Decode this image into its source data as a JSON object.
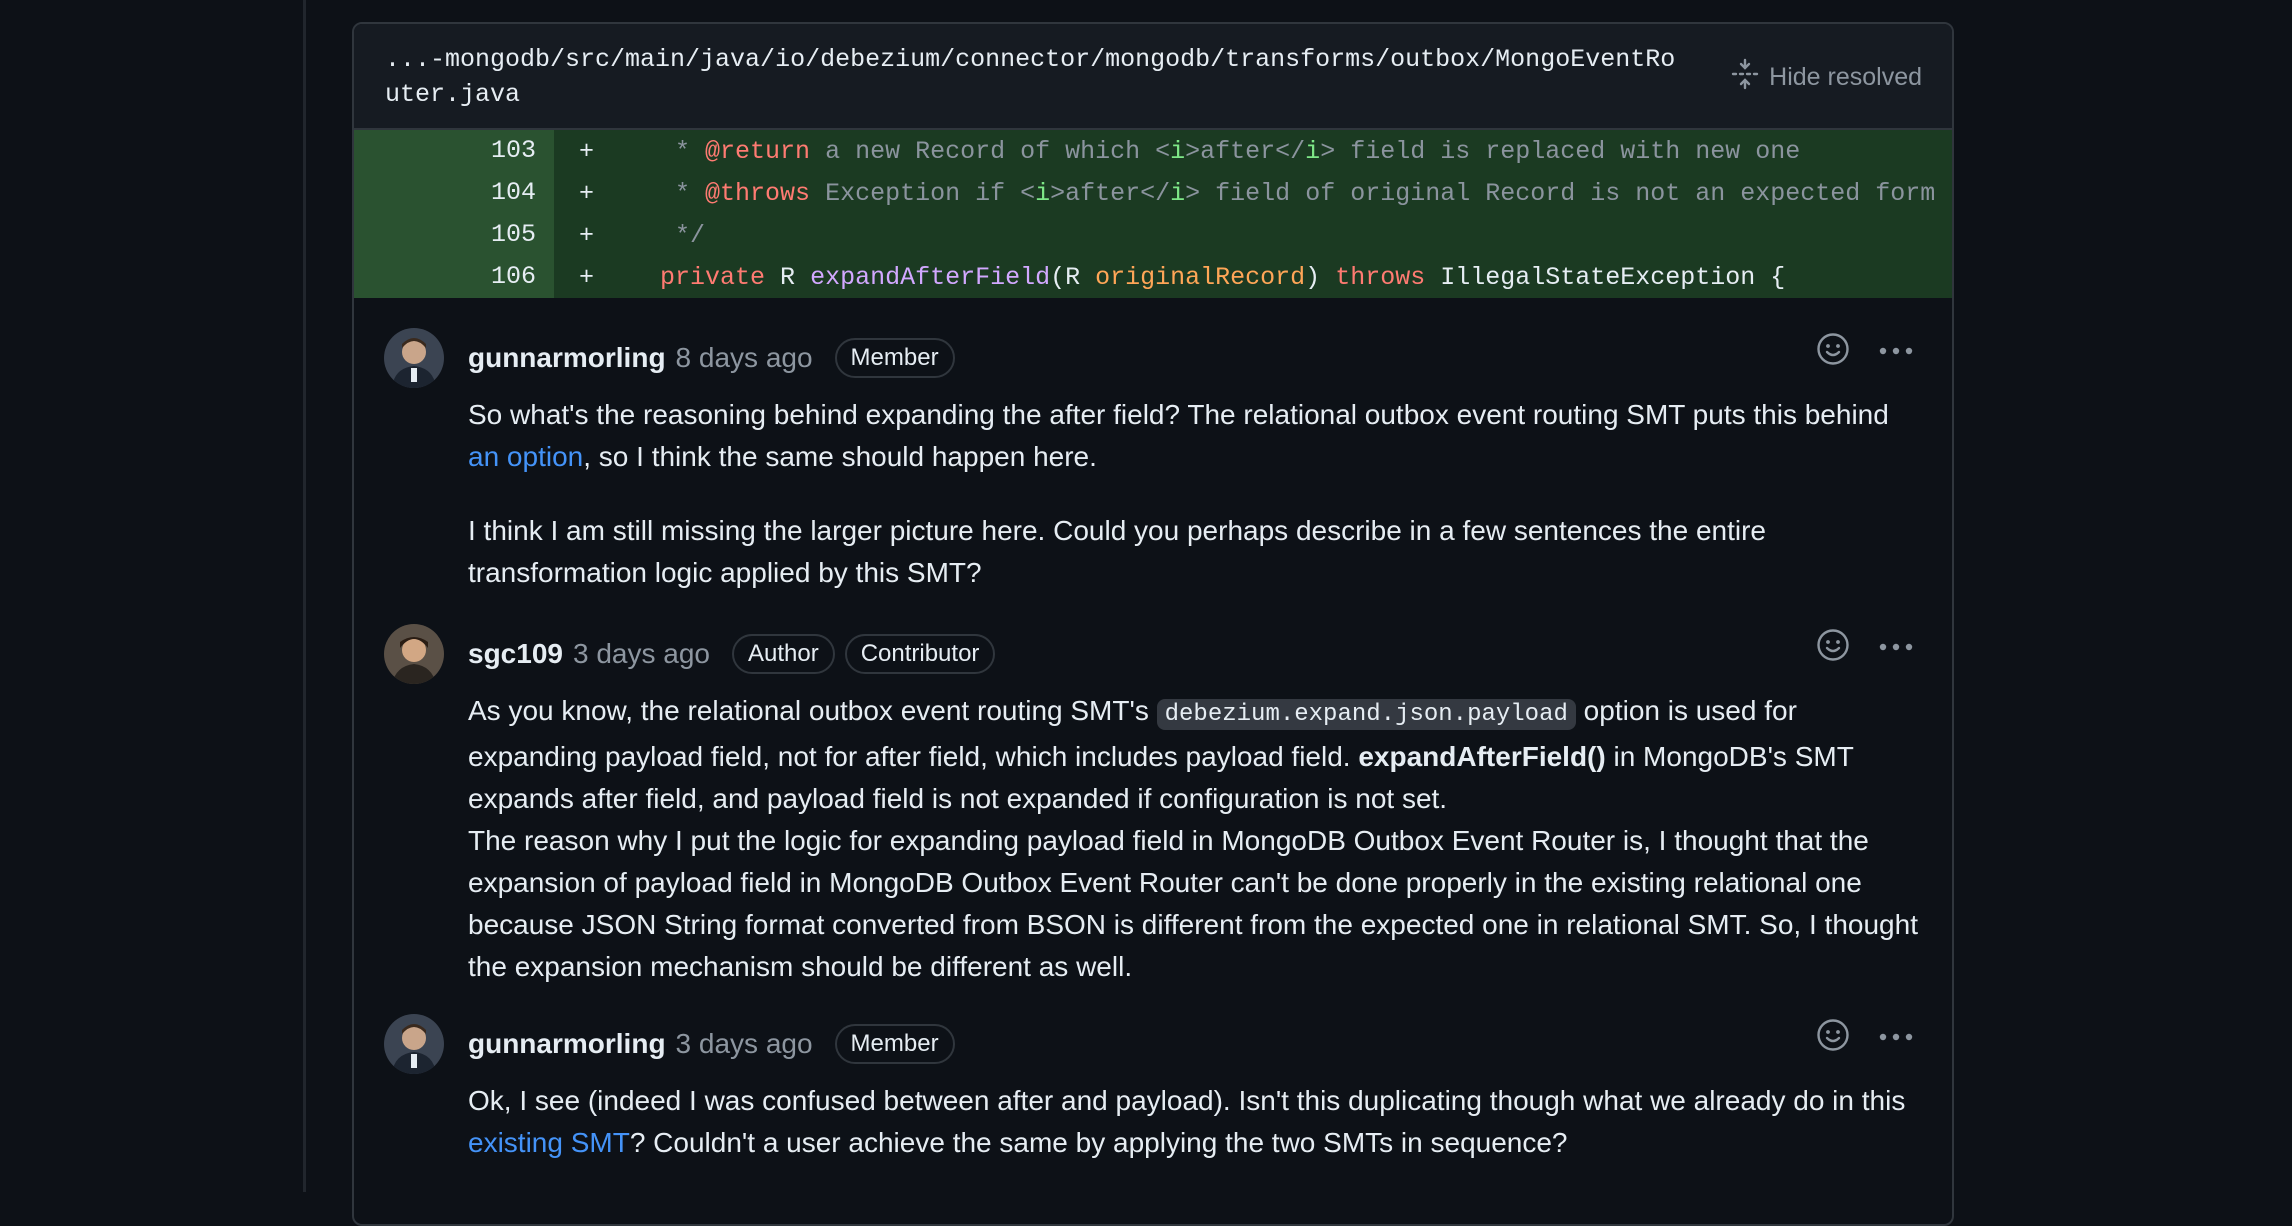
{
  "file": {
    "path": "...-mongodb/src/main/java/io/debezium/connector/mongodb/transforms/outbox/MongoEventRouter.java",
    "hide_resolved_label": "Hide resolved"
  },
  "diff": {
    "lines": [
      {
        "number": "103",
        "sign": "+"
      },
      {
        "number": "104",
        "sign": "+"
      },
      {
        "number": "105",
        "sign": "+"
      },
      {
        "number": "106",
        "sign": "+"
      }
    ],
    "code": {
      "l103": {
        "star": "     * ",
        "tag": "@return",
        "a": " a new Record of which <",
        "i": "i",
        "b": ">after</",
        "i2": "i",
        "c": "> field is replaced with new one"
      },
      "l104": {
        "star": "     * ",
        "tag": "@throws",
        "a": " Exception if <",
        "i": "i",
        "b": ">after</",
        "i2": "i",
        "c": "> field of original Record is not an expected form"
      },
      "l105": {
        "text": "     */"
      },
      "l106": {
        "indent": "    ",
        "kw1": "private",
        "t1": " R ",
        "fn": "expandAfterField",
        "t2": "(R ",
        "param": "originalRecord",
        "t3": ") ",
        "kw2": "throws",
        "t4": " IllegalStateException {"
      }
    }
  },
  "comments": [
    {
      "author": "gunnarmorling",
      "time": "8 days ago",
      "badges": [
        "Member"
      ],
      "p1_a": "So what's the reasoning behind expanding the after field? The relational outbox event routing SMT puts this behind ",
      "p1_link": "an option",
      "p1_b": ", so I think the same should happen here.",
      "p2": "I think I am still missing the larger picture here. Could you perhaps describe in a few sentences the entire transformation logic applied by this SMT?"
    },
    {
      "author": "sgc109",
      "time": "3 days ago",
      "badges": [
        "Author",
        "Contributor"
      ],
      "p1_a": "As you know, the relational outbox event routing SMT's ",
      "p1_code": "debezium.expand.json.payload",
      "p1_b": " option is used for expanding payload field, not for after field, which includes payload field. ",
      "p1_bold": "expandAfterField()",
      "p1_c": " in MongoDB's SMT expands after field, and payload field is not expanded if configuration is not set.",
      "p2": "The reason why I put the logic for expanding payload field in MongoDB Outbox Event Router is, I thought that the expansion of payload field in MongoDB Outbox Event Router can't be done properly in the existing relational one because JSON String format converted from BSON is different from the expected one in relational SMT. So, I thought the expansion mechanism should be different as well."
    },
    {
      "author": "gunnarmorling",
      "time": "3 days ago",
      "badges": [
        "Member"
      ],
      "p1_a": "Ok, I see (indeed I was confused between after and payload). Isn't this duplicating though what we already do in this ",
      "p1_link": "existing SMT",
      "p1_b": "? Couldn't a user achieve the same by applying the two SMTs in sequence?"
    }
  ],
  "icons": {
    "unfold": "unfold-icon",
    "reaction": "smiley-icon",
    "more": "kebab-horizontal-icon"
  },
  "colors": {
    "background": "#0d1117",
    "diff_added_bg": "#1b3a22",
    "link": "#4493f8"
  }
}
